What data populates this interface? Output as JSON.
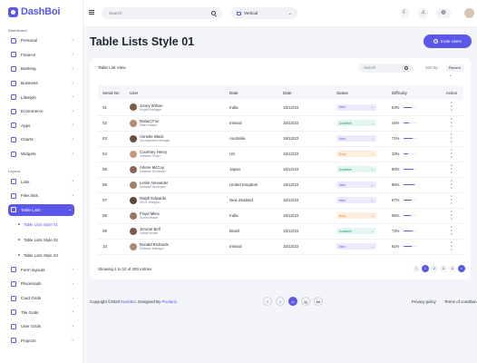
{
  "app": {
    "name": "DashBoi"
  },
  "sidebar": {
    "section_dashboard": "Dashboard",
    "section_layout": "Layout",
    "dashboard_items": [
      {
        "label": "Personal",
        "icon": "user-icon"
      },
      {
        "label": "Finance",
        "icon": "finance-icon"
      },
      {
        "label": "Banking",
        "icon": "bank-icon"
      },
      {
        "label": "Business",
        "icon": "briefcase-icon"
      },
      {
        "label": "Lifestyle",
        "icon": "lifestyle-icon"
      },
      {
        "label": "Ecommerce",
        "icon": "cart-icon"
      },
      {
        "label": "Apps",
        "icon": "apps-icon"
      },
      {
        "label": "Charts",
        "icon": "chart-icon"
      },
      {
        "label": "Widgets",
        "icon": "widget-icon"
      }
    ],
    "layout_items_top": [
      {
        "label": "Lists"
      },
      {
        "label": "Files lists"
      },
      {
        "label": "Table Lists"
      }
    ],
    "sub_items": [
      {
        "label": "Table Lists Style 01"
      },
      {
        "label": "Table Lists Style 02"
      },
      {
        "label": "Table Lists Style 03"
      }
    ],
    "layout_items_bottom": [
      {
        "label": "Form layouts"
      },
      {
        "label": "Placeloads"
      },
      {
        "label": "Card Grids"
      },
      {
        "label": "Tile Grids"
      },
      {
        "label": "User Grids"
      },
      {
        "label": "Projects"
      }
    ]
  },
  "topbar": {
    "search_placeholder": "Search",
    "layout_value": "Vertical"
  },
  "page": {
    "title": "Table Lists Style 01",
    "invite_label": "Invite Users"
  },
  "card": {
    "title": "Table List View",
    "search_placeholder": "Search",
    "sort_label": "Sort By :",
    "sort_value": "Recent"
  },
  "table": {
    "headers": [
      "Serial No",
      "User",
      "Date",
      "Date",
      "Status",
      "Difficulty",
      "Action"
    ],
    "rows": [
      {
        "no": "01",
        "name": "Jonny Wilson",
        "role": "Project Manager",
        "location": "India",
        "date": "15/12/23",
        "status": "New",
        "status_type": "new",
        "difficulty": "63%",
        "progress": 0.63
      },
      {
        "no": "02",
        "name": "Robert Fox",
        "role": "Team Leader",
        "location": "Ireland",
        "date": "15/12/23",
        "status": "Available",
        "status_type": "available",
        "difficulty": "44%",
        "progress": 0.44
      },
      {
        "no": "03",
        "name": "Annette Black",
        "role": "Development Manager",
        "location": "Australia",
        "date": "15/12/23",
        "status": "New",
        "status_type": "new",
        "difficulty": "71%",
        "progress": 0.71
      },
      {
        "no": "04",
        "name": "Courtney Henry",
        "role": "Software Tester",
        "location": "US",
        "date": "15/12/23",
        "status": "Busy",
        "status_type": "busy",
        "difficulty": "33%",
        "progress": 0.33
      },
      {
        "no": "05",
        "name": "Arlene McCoy",
        "role": "Software Developer",
        "location": "Japan",
        "date": "15/12/23",
        "status": "Available",
        "status_type": "available",
        "difficulty": "80%",
        "progress": 0.8
      },
      {
        "no": "06",
        "name": "Leslie Alexander",
        "role": "Software Developer",
        "location": "United Kingdom",
        "date": "15/12/23",
        "status": "New",
        "status_type": "new",
        "difficulty": "88%",
        "progress": 0.88
      },
      {
        "no": "07",
        "name": "Ralph Edwards",
        "role": "UI/UX Designer",
        "location": "New Zealand",
        "date": "15/12/23",
        "status": "New",
        "status_type": "new",
        "difficulty": "67%",
        "progress": 0.67
      },
      {
        "no": "08",
        "name": "Floyd Miles",
        "role": "Scrum Master",
        "location": "India",
        "date": "15/12/23",
        "status": "Busy",
        "status_type": "busy",
        "difficulty": "55%",
        "progress": 0.55
      },
      {
        "no": "09",
        "name": "Jerome Bell",
        "role": "Virtual Intuder",
        "location": "Brazil",
        "date": "15/12/23",
        "status": "Available",
        "status_type": "available",
        "difficulty": "73%",
        "progress": 0.73
      },
      {
        "no": "10",
        "name": "Ronald Richards",
        "role": "Software Manager",
        "location": "Ireland",
        "date": "15/12/23",
        "status": "New",
        "status_type": "new",
        "difficulty": "61%",
        "progress": 0.61
      }
    ],
    "action_icon": "more-vertical-icon"
  },
  "pagination": {
    "summary": "Showing 1 to 10 of 200 entries",
    "pages": [
      "<",
      "1",
      "2",
      "3",
      "4",
      ">"
    ],
    "active_page": "1"
  },
  "footer": {
    "copyright_prefix": "Copyright ©2023 ",
    "brand": "DashBoi",
    "designed_by_prefix": ". Designed By ",
    "designer": "Pixelaris",
    "socials": [
      "f",
      "t",
      "in",
      "ig",
      "be"
    ],
    "privacy": "Privacy policy",
    "terms": "Terms of condition"
  },
  "colors": {
    "accent": "#5b57e8",
    "available": "#18a37c",
    "busy": "#f08a2c"
  }
}
